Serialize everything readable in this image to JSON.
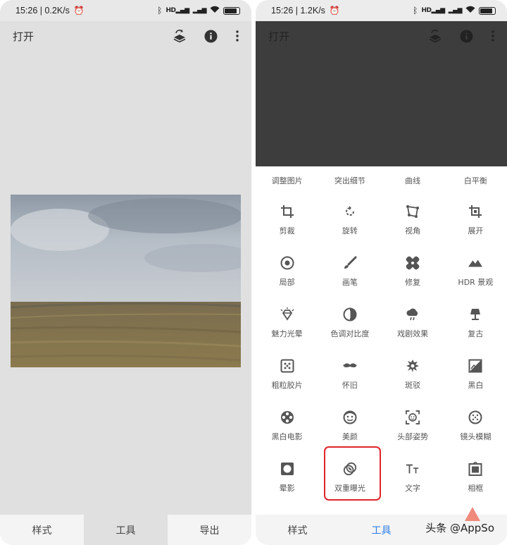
{
  "left": {
    "status": {
      "time": "15:26",
      "speed": "0.2K/s"
    },
    "appbar": {
      "open_label": "打开"
    },
    "bottomnav": [
      "样式",
      "工具",
      "导出"
    ]
  },
  "right": {
    "status": {
      "time": "15:26",
      "speed": "1.2K/s"
    },
    "appbar": {
      "open_label": "打开"
    },
    "top_row": [
      "调整图片",
      "突出细节",
      "曲线",
      "白平衡"
    ],
    "tools": [
      {
        "label": "剪裁",
        "icon": "crop-icon"
      },
      {
        "label": "旋转",
        "icon": "rotate-icon"
      },
      {
        "label": "视角",
        "icon": "perspective-icon"
      },
      {
        "label": "展开",
        "icon": "expand-icon"
      },
      {
        "label": "局部",
        "icon": "selective-icon"
      },
      {
        "label": "画笔",
        "icon": "brush-icon"
      },
      {
        "label": "修复",
        "icon": "healing-icon"
      },
      {
        "label": "HDR 景观",
        "icon": "hdr-icon"
      },
      {
        "label": "魅力光晕",
        "icon": "glamour-glow-icon"
      },
      {
        "label": "色调对比度",
        "icon": "tonal-contrast-icon"
      },
      {
        "label": "戏剧效果",
        "icon": "drama-icon"
      },
      {
        "label": "复古",
        "icon": "vintage-icon"
      },
      {
        "label": "粗粒胶片",
        "icon": "grainy-film-icon"
      },
      {
        "label": "怀旧",
        "icon": "retrolux-icon"
      },
      {
        "label": "斑驳",
        "icon": "grunge-icon"
      },
      {
        "label": "黑白",
        "icon": "black-white-icon"
      },
      {
        "label": "黑白电影",
        "icon": "noir-icon"
      },
      {
        "label": "美颜",
        "icon": "face-icon"
      },
      {
        "label": "头部姿势",
        "icon": "head-pose-icon"
      },
      {
        "label": "镜头模糊",
        "icon": "lens-blur-icon"
      },
      {
        "label": "晕影",
        "icon": "vignette-icon"
      },
      {
        "label": "双重曝光",
        "icon": "double-exposure-icon"
      },
      {
        "label": "文字",
        "icon": "text-icon"
      },
      {
        "label": "相框",
        "icon": "frames-icon"
      }
    ],
    "bottomnav": [
      "样式",
      "工具"
    ],
    "watermark": "头条 @AppSo"
  },
  "colors": {
    "accent": "#2f7ee8",
    "highlight": "#e0242a",
    "dark": "#3d3d3d"
  }
}
